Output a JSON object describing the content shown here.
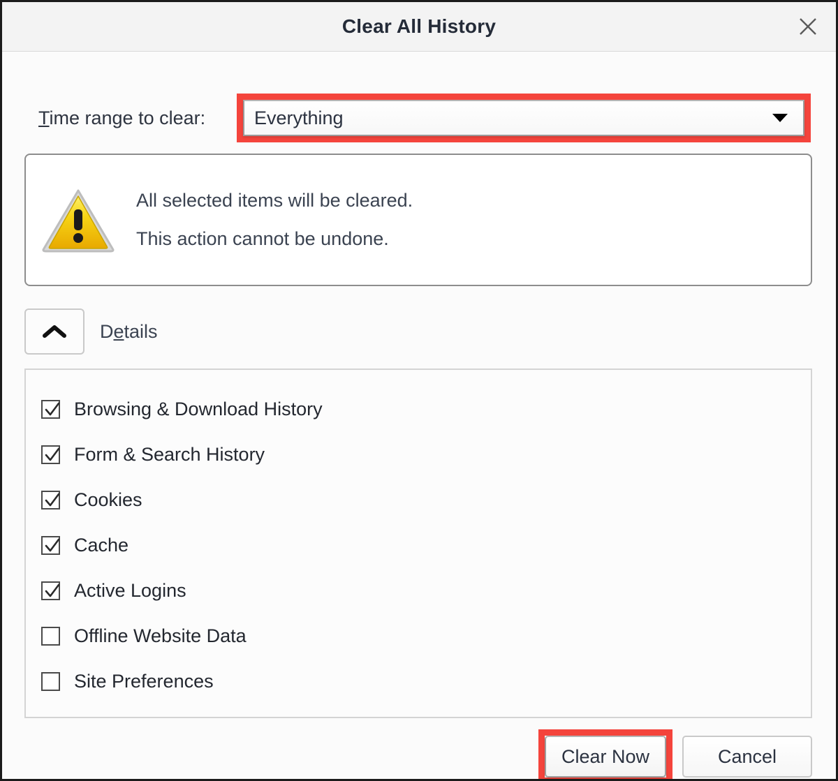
{
  "window": {
    "title": "Clear All History",
    "close_icon": "close-icon"
  },
  "time_range": {
    "label_prefix": "T",
    "label_rest": "ime range to clear:",
    "selected_value": "Everything",
    "arrow_icon": "chevron-down-icon",
    "highlight_color": "#f4443c"
  },
  "warning": {
    "icon": "warning-triangle-icon",
    "line1": "All selected items will be cleared.",
    "line2": "This action cannot be undone."
  },
  "details": {
    "toggle_icon": "chevron-up-icon",
    "label_prefix": "D",
    "label_key": "e",
    "label_rest": "tails"
  },
  "checklist": {
    "items": [
      {
        "label": "Browsing & Download History",
        "checked": true
      },
      {
        "label": "Form & Search History",
        "checked": true
      },
      {
        "label": "Cookies",
        "checked": true
      },
      {
        "label": "Cache",
        "checked": true
      },
      {
        "label": "Active Logins",
        "checked": true
      },
      {
        "label": "Offline Website Data",
        "checked": false
      },
      {
        "label": "Site Preferences",
        "checked": false
      }
    ]
  },
  "footer": {
    "clear_now_label": "Clear Now",
    "cancel_label": "Cancel",
    "highlight_color": "#f4443c"
  }
}
